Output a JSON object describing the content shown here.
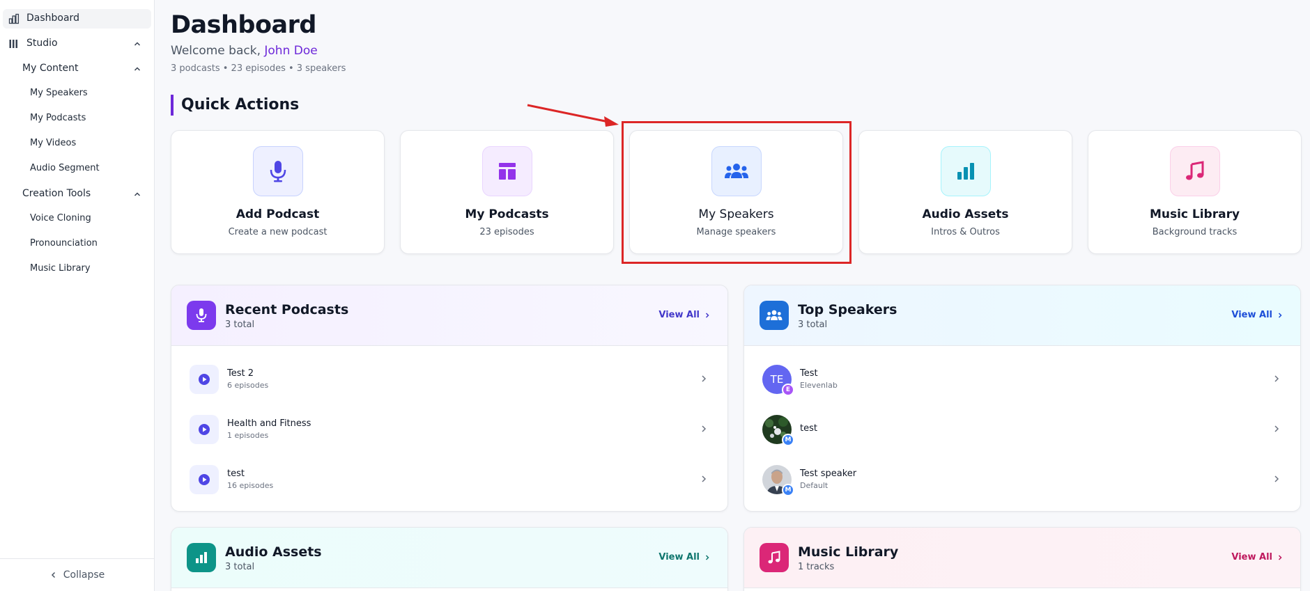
{
  "sidebar": {
    "items": [
      {
        "label": "Dashboard"
      },
      {
        "label": "Studio"
      },
      {
        "label": "My Content"
      },
      {
        "label": "My Speakers"
      },
      {
        "label": "My Podcasts"
      },
      {
        "label": "My Videos"
      },
      {
        "label": "Audio Segment"
      },
      {
        "label": "Creation Tools"
      },
      {
        "label": "Voice Cloning"
      },
      {
        "label": "Pronounciation"
      },
      {
        "label": "Music Library"
      }
    ],
    "collapse_label": "Collapse"
  },
  "header": {
    "title": "Dashboard",
    "welcome_prefix": "Welcome back,",
    "user_name": "John Doe",
    "stats": "3 podcasts • 23 episodes • 3 speakers"
  },
  "quick_actions": {
    "title": "Quick Actions",
    "cards": [
      {
        "title": "Add Podcast",
        "subtitle": "Create a new podcast",
        "icon": "microphone-icon"
      },
      {
        "title": "My Podcasts",
        "subtitle": "23 episodes",
        "icon": "layout-icon"
      },
      {
        "title": "My Speakers",
        "subtitle": "Manage speakers",
        "icon": "users-icon"
      },
      {
        "title": "Audio Assets",
        "subtitle": "Intros & Outros",
        "icon": "bar-chart-icon"
      },
      {
        "title": "Music Library",
        "subtitle": "Background tracks",
        "icon": "music-note-icon"
      }
    ]
  },
  "recent_podcasts": {
    "title": "Recent Podcasts",
    "subtitle": "3 total",
    "view_all": "View All",
    "items": [
      {
        "title": "Test 2",
        "subtitle": "6 episodes"
      },
      {
        "title": "Health and Fitness",
        "subtitle": "1 episodes"
      },
      {
        "title": "test",
        "subtitle": "16 episodes"
      }
    ]
  },
  "top_speakers": {
    "title": "Top Speakers",
    "subtitle": "3 total",
    "view_all": "View All",
    "items": [
      {
        "name": "Test",
        "provider": "Elevenlab",
        "initials": "TE",
        "badge": "E"
      },
      {
        "name": "test",
        "provider": "",
        "badge": "M"
      },
      {
        "name": "Test speaker",
        "provider": "Default",
        "badge": "M"
      }
    ]
  },
  "audio_assets": {
    "title": "Audio Assets",
    "subtitle": "3 total",
    "view_all": "View All"
  },
  "music_library": {
    "title": "Music Library",
    "subtitle": "1 tracks",
    "view_all": "View All"
  },
  "colors": {
    "accent": "#6d28d9",
    "highlight": "#dc2626",
    "speakers_blue": "#1d4ed8",
    "teal": "#0d9488",
    "pink": "#db2777"
  }
}
